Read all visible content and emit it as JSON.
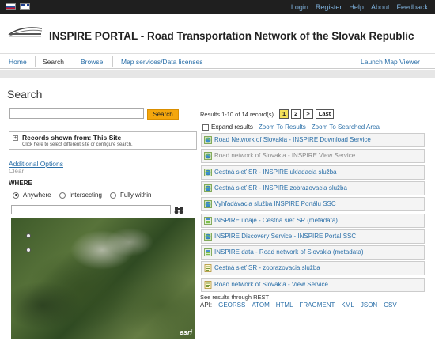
{
  "topbar": {
    "flags": [
      "flag-slovakia-icon",
      "flag-uk-icon"
    ],
    "links": [
      "Login",
      "Register",
      "Help",
      "About",
      "Feedback"
    ]
  },
  "header": {
    "title": "INSPIRE PORTAL - Road Transportation Network of the Slovak Republic"
  },
  "nav": {
    "items": [
      "Home",
      "Search",
      "Browse",
      "Map services/Data licenses"
    ],
    "active": "Search",
    "right": "Launch Map Viewer"
  },
  "search": {
    "title": "Search",
    "query": "",
    "button": "Search",
    "records_label": "Records shown from:",
    "records_site": "This Site",
    "records_hint": "Click here to select different site or configure search.",
    "advanced": "Additional Options",
    "clear": "Clear",
    "where_label": "WHERE",
    "where_options": [
      "Anywhere",
      "Intersecting",
      "Fully within"
    ],
    "where_selected": "Anywhere",
    "location_query": "",
    "map_logo": "esri"
  },
  "results": {
    "summary": "Results 1-10 of 14 record(s)",
    "pages": [
      "1",
      "2",
      ">",
      "Last"
    ],
    "current_page": "1",
    "expand_label": "Expand results",
    "zoom_results": "Zoom To Results",
    "zoom_area": "Zoom To Searched Area",
    "items": [
      {
        "title": "Road Network of Slovakia - INSPIRE Download Service",
        "icon": "globe-icon",
        "style": "blue"
      },
      {
        "title": "Road network of Slovakia - INSPIRE View Service",
        "icon": "globe-icon",
        "style": "gray"
      },
      {
        "title": "Cestná sieť SR - INSPIRE ukladacia služba",
        "icon": "globe-icon",
        "style": "blue"
      },
      {
        "title": "Cestná sieť SR - INSPIRE zobrazovacia služba",
        "icon": "globe-icon",
        "style": "blue"
      },
      {
        "title": "Vyhľadávacia služba INSPIRE Portálu SSC",
        "icon": "globe-icon",
        "style": "blue"
      },
      {
        "title": "INSPIRE údaje - Cestná sieť SR (metadáta)",
        "icon": "dataset-icon",
        "style": "blue"
      },
      {
        "title": "INSPIRE Discovery Service - INSPIRE Portal SSC",
        "icon": "globe-icon",
        "style": "blue"
      },
      {
        "title": "INSPIRE data - Road network of Slovakia (metadata)",
        "icon": "dataset-icon",
        "style": "blue"
      },
      {
        "title": "Cestná sieť SR - zobrazovacia služba",
        "icon": "document-icon",
        "style": "blue"
      },
      {
        "title": "Road network of Slovakia - View Service",
        "icon": "document-icon",
        "style": "blue"
      }
    ],
    "rest_label": "See results through REST",
    "api_label": "API:",
    "api_formats": [
      "GEORSS",
      "ATOM",
      "HTML",
      "FRAGMENT",
      "KML",
      "JSON",
      "CSV"
    ]
  }
}
